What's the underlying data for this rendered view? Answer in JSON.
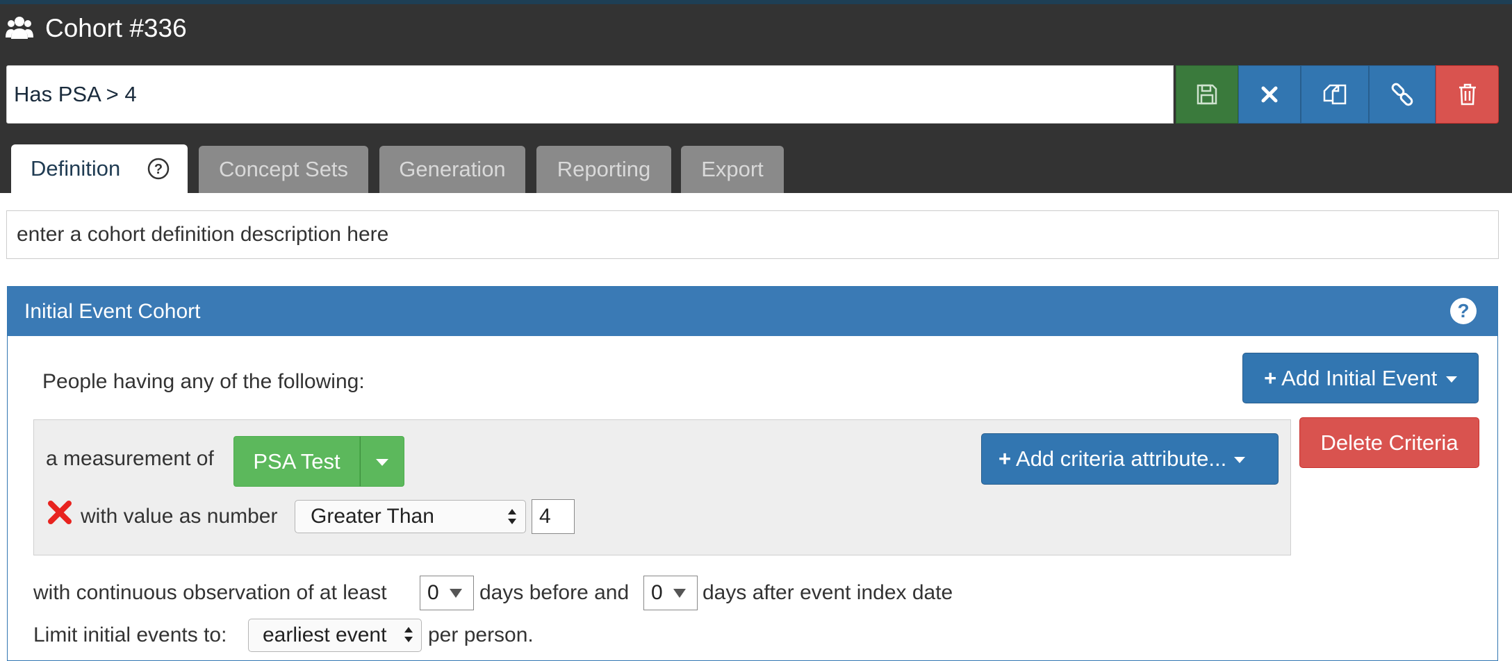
{
  "header": {
    "title": "Cohort #336",
    "title_icon": "users-icon",
    "cohort_name": "Has PSA > 4",
    "actions": [
      {
        "name": "save",
        "icon": "save-icon",
        "color": "#3a7a3c"
      },
      {
        "name": "close",
        "icon": "close-icon",
        "color": "#3276b1"
      },
      {
        "name": "copy",
        "icon": "copy-icon",
        "color": "#3276b1"
      },
      {
        "name": "link",
        "icon": "link-icon",
        "color": "#3276b1"
      },
      {
        "name": "delete",
        "icon": "trash-icon",
        "color": "#d9534f"
      }
    ]
  },
  "tabs": [
    {
      "label": "Definition",
      "active": true
    },
    {
      "label": "Concept Sets",
      "active": false
    },
    {
      "label": "Generation",
      "active": false
    },
    {
      "label": "Reporting",
      "active": false
    },
    {
      "label": "Export",
      "active": false
    }
  ],
  "description": {
    "placeholder": "enter a cohort definition description here"
  },
  "initial_event_panel": {
    "title": "Initial Event Cohort",
    "people_label": "People having any of the following:",
    "add_initial_event_label": "Add Initial Event",
    "delete_criteria_label": "Delete Criteria",
    "criteria": {
      "measurement_label": "a measurement of",
      "concept_set": "PSA Test",
      "add_attribute_label": "Add criteria attribute...",
      "value_label": "with value as number",
      "operator": "Greater Than",
      "value": "4"
    },
    "observation": {
      "prefix": "with continuous observation of at least",
      "days_before": "0",
      "middle": "days before and",
      "days_after": "0",
      "suffix": "days after event index date"
    },
    "limit": {
      "prefix": "Limit initial events to:",
      "selected": "earliest event",
      "suffix": "per person."
    }
  },
  "colors": {
    "header_bg": "#333333",
    "primary": "#3276b1",
    "success": "#5cb85c",
    "danger": "#d9534f"
  }
}
